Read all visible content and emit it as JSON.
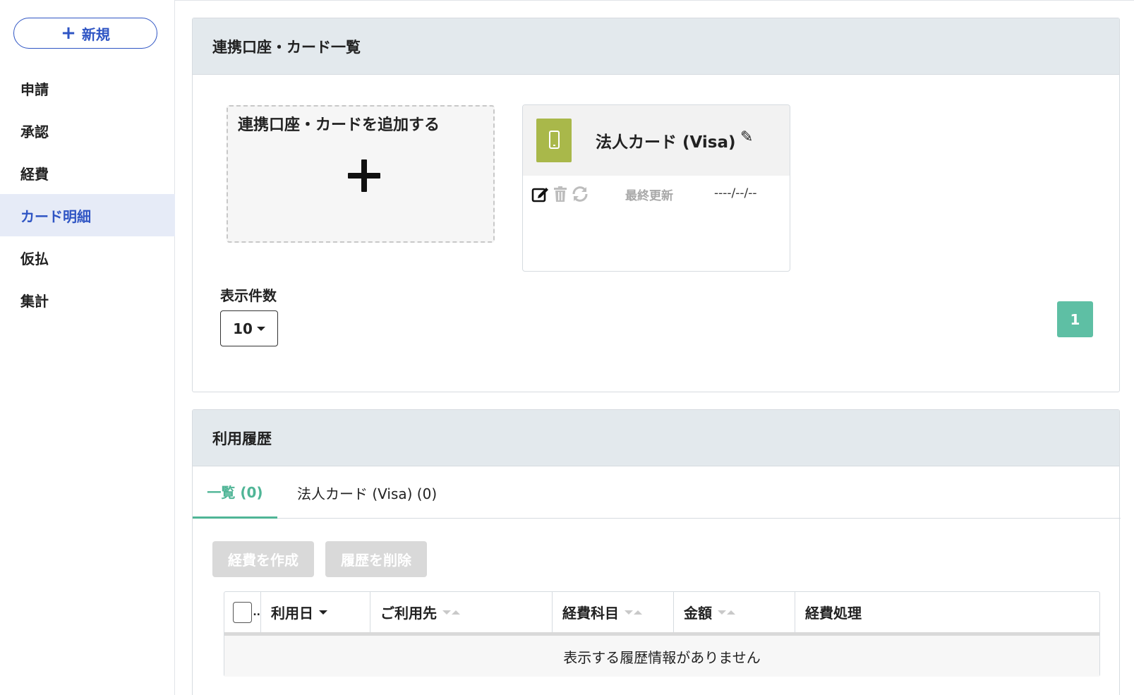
{
  "sidebar": {
    "new_button": "新規",
    "items": [
      {
        "label": "申請"
      },
      {
        "label": "承認"
      },
      {
        "label": "経費"
      },
      {
        "label": "カード明細",
        "active": true
      },
      {
        "label": "仮払"
      },
      {
        "label": "集計"
      }
    ]
  },
  "accounts_panel": {
    "title": "連携口座・カード一覧",
    "add_card_label": "連携口座・カードを追加する",
    "card": {
      "name": "法人カード (Visa)",
      "icon": "phone-icon",
      "icon_color": "#a9b84a",
      "last_updated_label": "最終更新",
      "last_updated_value": "----/--/--"
    },
    "per_page_label": "表示件数",
    "per_page_value": "10",
    "current_page": "1",
    "accent_color": "#5ebfa4"
  },
  "history_panel": {
    "title": "利用履歴",
    "tabs": [
      {
        "label": "一覧 (0)",
        "active": true
      },
      {
        "label": "法人カード (Visa) (0)"
      }
    ],
    "create_button": "経費を作成",
    "delete_button": "履歴を削除",
    "columns": [
      "利用日",
      "ご利用先",
      "経費科目",
      "金額",
      "経費処理"
    ],
    "checkbox_col_truncated": "..",
    "empty_message": "表示する履歴情報がありません"
  }
}
